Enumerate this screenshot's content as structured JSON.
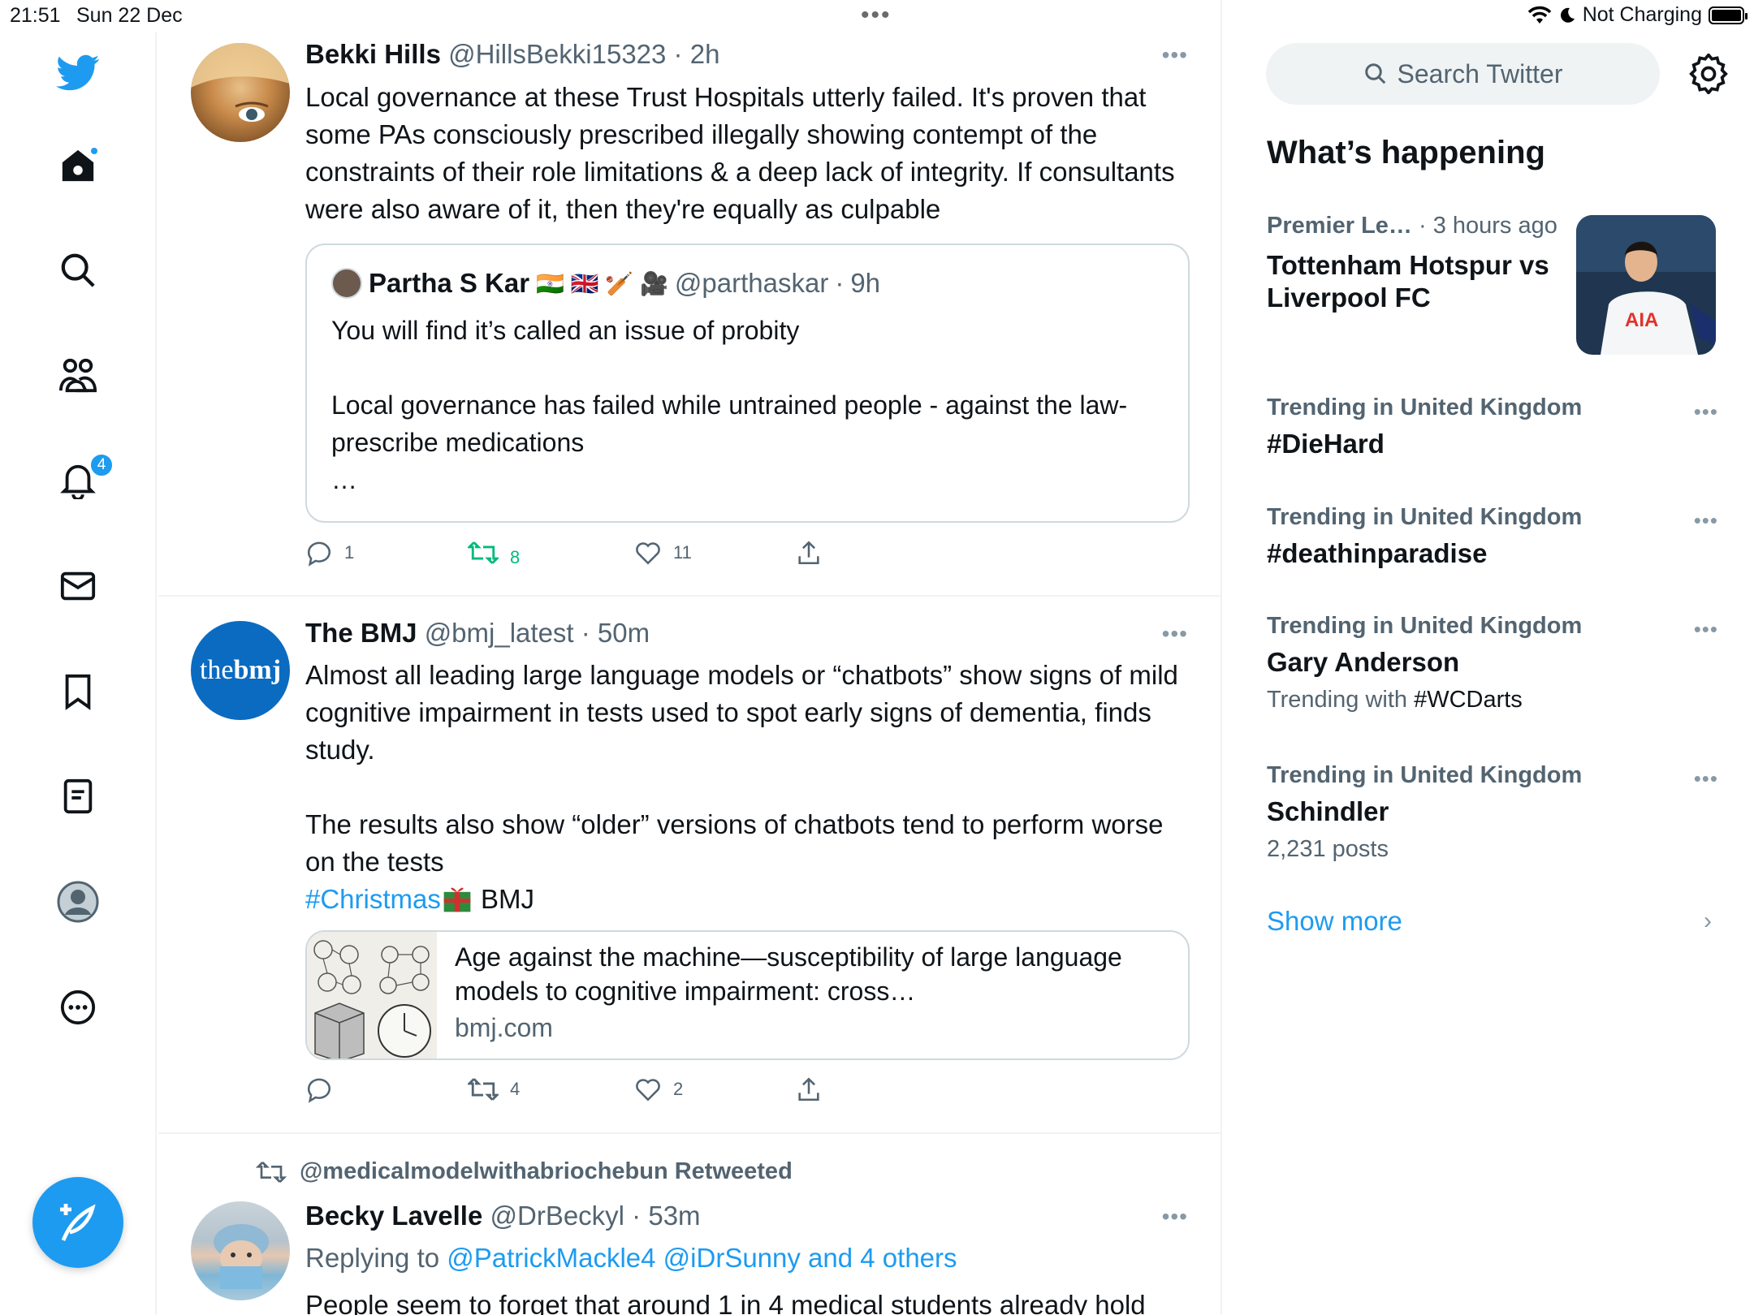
{
  "status_bar": {
    "time": "21:51",
    "date": "Sun 22 Dec",
    "charging": "Not Charging"
  },
  "nav": {
    "notifications_badge": "4",
    "items": [
      "twitter-logo",
      "home-icon",
      "search-icon",
      "communities-icon",
      "notifications-icon",
      "messages-icon",
      "bookmarks-icon",
      "lists-icon",
      "profile-icon",
      "more-icon"
    ]
  },
  "tweets": [
    {
      "name": "Bekki Hills",
      "handle": "@HillsBekki15323",
      "time": "2h",
      "text": "Local governance at these Trust Hospitals utterly failed. It's proven that some PAs consciously prescribed illegally showing contempt of the constraints of their role limitations & a deep lack of integrity. If consultants were also aware of it, then they're equally as culpable",
      "quote": {
        "name": "Partha S Kar",
        "emoji": "🇮🇳 🇬🇧 🏏 🎥",
        "handle": "@parthaskar",
        "time": "9h",
        "text": "You will find it’s called an issue of probity\n\nLocal governance has failed while untrained people - against the law- prescribe medications\n…"
      },
      "replies": "1",
      "retweets": "8",
      "likes": "11"
    },
    {
      "name": "The BMJ",
      "handle": "@bmj_latest",
      "time": "50m",
      "avatar_text_a": "the",
      "avatar_text_b": "bmj",
      "text": "Almost all leading large language models or “chatbots” show signs of mild cognitive impairment in tests used to spot early signs of dementia, finds study.\n\nThe results also show “older” versions of chatbots tend to perform worse on the tests",
      "hashtag": "#Christmas",
      "hashtag_suffix": " BMJ",
      "card": {
        "title": "Age against the machine—susceptibility of large language models to cognitive impairment: cross…",
        "domain": "bmj.com"
      },
      "replies": "",
      "retweets": "4",
      "likes": "2"
    },
    {
      "retweeted_by": "@medicalmodelwithabriochebun Retweeted",
      "name": "Becky Lavelle",
      "handle": "@DrBeckyl",
      "time": "53m",
      "replying_prefix": "Replying to ",
      "replying_to": "@PatrickMackle4 @iDrSunny and 4 others",
      "text": "People seem to forget that around 1 in 4 medical students already hold"
    }
  ],
  "sidebar": {
    "search_placeholder": "Search Twitter",
    "section_title": "What’s happening",
    "news": {
      "category": "Premier Le…",
      "time": " · 3 hours ago",
      "title": "Tottenham Hotspur vs Liverpool FC",
      "image_text": "AIA"
    },
    "trends": [
      {
        "category": "Trending in United Kingdom",
        "name": "#DieHard",
        "sub_prefix": "",
        "sub": ""
      },
      {
        "category": "Trending in United Kingdom",
        "name": "#deathinparadise",
        "sub_prefix": "",
        "sub": ""
      },
      {
        "category": "Trending in United Kingdom",
        "name": "Gary Anderson",
        "sub_prefix": "Trending with ",
        "sub": "#WCDarts"
      },
      {
        "category": "Trending in United Kingdom",
        "name": "Schindler",
        "sub_prefix": "",
        "sub": "2,231 posts"
      }
    ],
    "show_more": "Show more"
  },
  "colors": {
    "accent": "#1d9bf0",
    "retweet_green": "#00ba7c",
    "text": "#0f1419",
    "muted": "#536471"
  }
}
